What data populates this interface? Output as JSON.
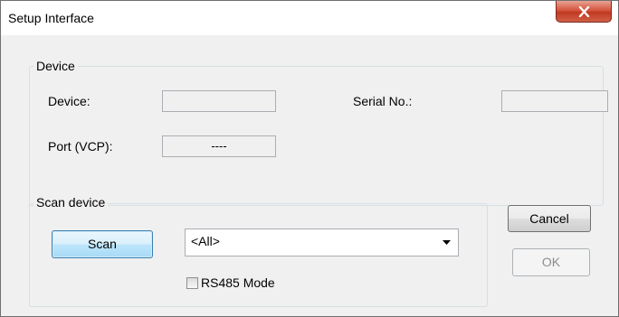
{
  "window": {
    "title": "Setup Interface",
    "close_icon": "close-x-icon",
    "close_color": "#c7412b"
  },
  "device_group": {
    "title": "Device",
    "device_label": "Device:",
    "device_value": "",
    "serial_label": "Serial No.:",
    "serial_value": "",
    "port_label": "Port (VCP):",
    "port_value": "----"
  },
  "scan_group": {
    "title": "Scan device",
    "scan_button": "Scan",
    "device_filter": {
      "selected": "<All>",
      "arrow_icon": "dropdown-arrow-icon"
    },
    "rs485_label": "RS485 Mode",
    "rs485_checked": false
  },
  "actions": {
    "cancel": "Cancel",
    "ok": "OK",
    "ok_enabled": false
  }
}
